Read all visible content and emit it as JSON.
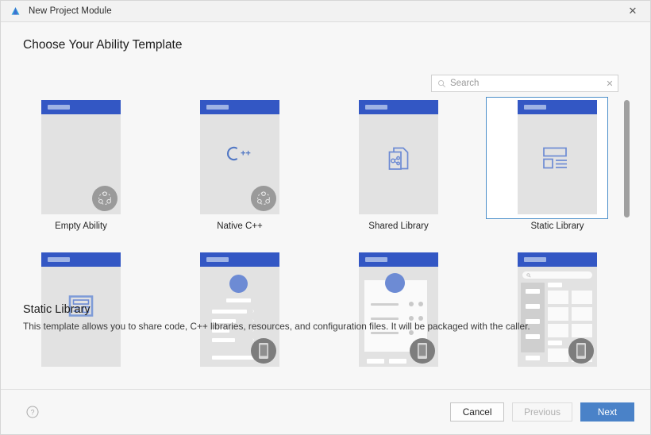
{
  "window": {
    "title": "New Project Module",
    "app_icon": "deveco-logo-icon",
    "close_label": "✕"
  },
  "page": {
    "title": "Choose Your Ability Template"
  },
  "search": {
    "placeholder": "Search",
    "value": "",
    "icon": "search-icon",
    "clear_label": "✕"
  },
  "templates": [
    {
      "label": "Empty Ability",
      "icon": "blank-icon",
      "badge": "ability-badge-icon",
      "selected": false
    },
    {
      "label": "Native C++",
      "icon": "cplusplus-icon",
      "badge": "ability-badge-icon",
      "selected": false
    },
    {
      "label": "Shared Library",
      "icon": "share-document-icon",
      "badge": "",
      "selected": false
    },
    {
      "label": "Static Library",
      "icon": "list-layout-icon",
      "badge": "",
      "selected": true
    },
    {
      "label": "",
      "icon": "article-layout-icon",
      "badge": "",
      "selected": false
    },
    {
      "label": "",
      "icon": "profile-mock-icon",
      "badge": "phone-badge-icon",
      "selected": false
    },
    {
      "label": "",
      "icon": "card-mock-icon",
      "badge": "phone-badge-icon",
      "selected": false
    },
    {
      "label": "",
      "icon": "catalog-mock-icon",
      "badge": "phone-badge-icon",
      "selected": false
    }
  ],
  "description": {
    "title": "Static Library",
    "text": "This template allows you to share code, C++ libraries, resources, and configuration files. It will be packaged with the caller."
  },
  "footer": {
    "help_icon": "help-circle-icon",
    "cancel_label": "Cancel",
    "previous_label": "Previous",
    "next_label": "Next"
  },
  "colors": {
    "accent_blue": "#4a82c8",
    "card_header_blue": "#3357c4",
    "selection_border": "#4d90ca",
    "card_body_gray": "#e2e2e2",
    "window_bg": "#f7f7f7"
  }
}
